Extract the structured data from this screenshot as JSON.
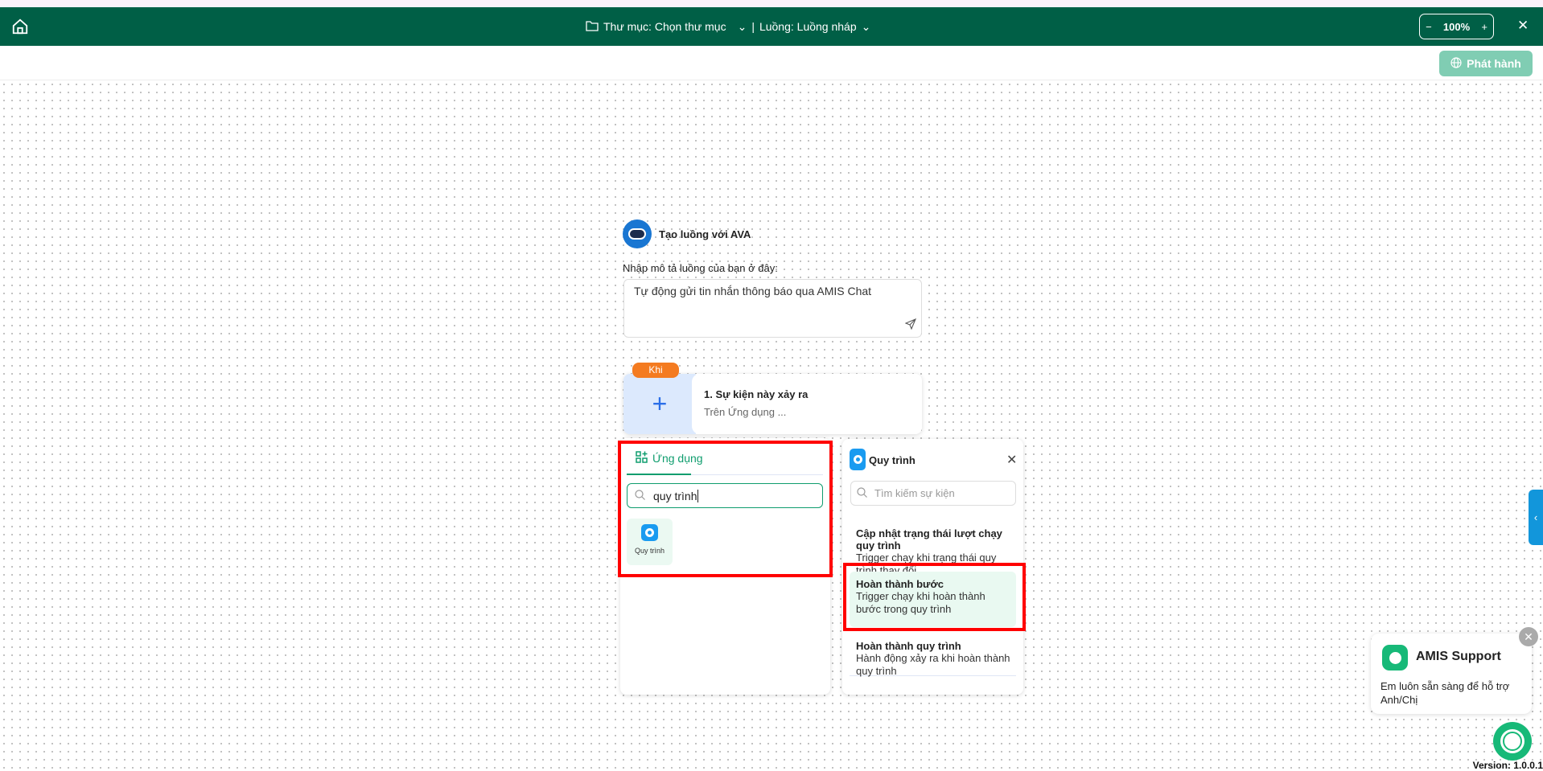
{
  "header": {
    "folder_label": "Thư mục: Chọn thư mục",
    "flow_label": "Luồng: Luồng nháp",
    "separator": "|",
    "zoom": "100%",
    "zoom_minus": "−",
    "zoom_plus": "+",
    "close": "✕"
  },
  "toolbar": {
    "publish_label": "Phát hành"
  },
  "ava": {
    "title": "Tạo luồng với AVA",
    "prompt_label": "Nhập mô tả luồng của bạn ở đây:",
    "prompt_value": "Tự động gửi tin nhắn thông báo qua AMIS Chat"
  },
  "trigger": {
    "badge": "Khi",
    "title": "1.  Sự kiện này xảy ra",
    "subtitle": "Trên Ứng dụng ..."
  },
  "app_panel": {
    "tab_label": "Ứng dụng",
    "search_value": "quy trình",
    "apps": [
      {
        "label": "Quy trình"
      }
    ]
  },
  "event_panel": {
    "title": "Quy trình",
    "search_placeholder": "Tìm kiếm sự kiện",
    "events": [
      {
        "title": "Cập nhật trạng thái lượt chạy quy trình",
        "desc": "Trigger chạy khi trạng thái quy trình thay đổi"
      },
      {
        "title": "Hoàn thành bước",
        "desc": "Trigger chạy khi hoàn thành bước trong quy trình"
      },
      {
        "title": "Hoàn thành quy trình",
        "desc": "Hành động xảy ra khi hoàn thành quy trình"
      }
    ]
  },
  "support": {
    "title": "AMIS Support",
    "message": "Em luôn sẵn sàng để hỗ trợ Anh/Chị"
  },
  "version": "Version: 1.0.0.1",
  "colors": {
    "header": "#005f46",
    "accent": "#0f9d6e",
    "publish": "#80cdb3",
    "highlight": "#e8f8f1",
    "annotation": "#ff0000"
  }
}
